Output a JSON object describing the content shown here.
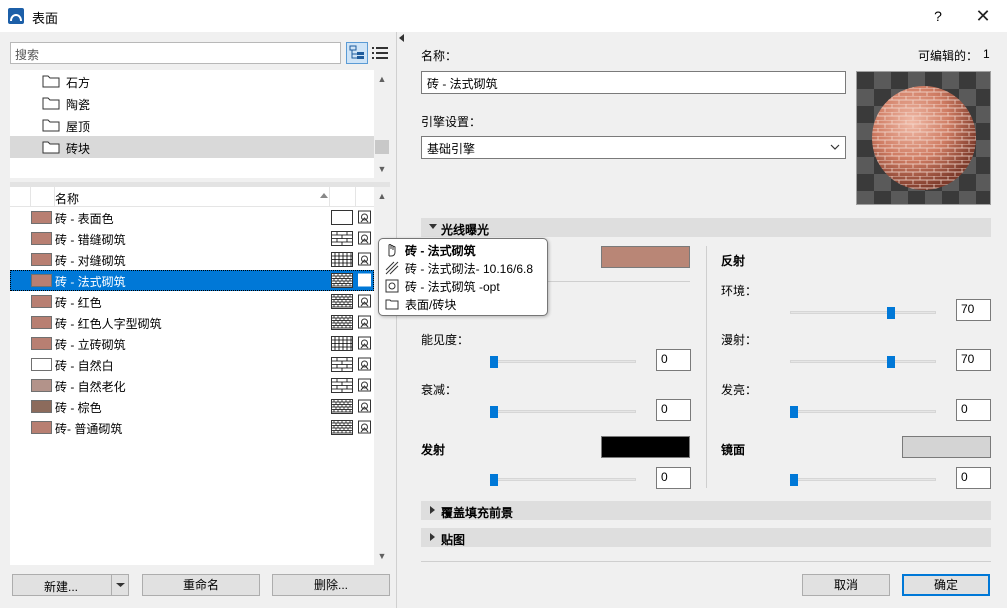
{
  "window": {
    "title": "表面",
    "help_label": "?",
    "close_label": "✕"
  },
  "search": {
    "placeholder": "搜索"
  },
  "folders": [
    {
      "label": "石方"
    },
    {
      "label": "陶瓷"
    },
    {
      "label": "屋顶"
    },
    {
      "label": "砖块",
      "selected": true
    }
  ],
  "material_list": {
    "header_name": "名称",
    "rows": [
      {
        "label": "砖 - 表面色",
        "color": "#b87f72",
        "pattern": "plain"
      },
      {
        "label": "砖 - 错缝砌筑",
        "color": "#b87f72",
        "pattern": "brick"
      },
      {
        "label": "砖 - 对缝砌筑",
        "color": "#b87f72",
        "pattern": "grid"
      },
      {
        "label": "砖 - 法式砌筑",
        "color": "#b87f72",
        "pattern": "dense",
        "selected": true
      },
      {
        "label": "砖 - 红色",
        "color": "#b87f72",
        "pattern": "dense"
      },
      {
        "label": "砖 - 红色人字型砌筑",
        "color": "#b87f72",
        "pattern": "dense"
      },
      {
        "label": "砖 - 立砖砌筑",
        "color": "#b87f72",
        "pattern": "grid"
      },
      {
        "label": "砖 - 自然白",
        "color": "#ffffff",
        "pattern": "brick"
      },
      {
        "label": "砖 - 自然老化",
        "color": "#b3938a",
        "pattern": "brick"
      },
      {
        "label": "砖 - 棕色",
        "color": "#8c6b5c",
        "pattern": "dense"
      },
      {
        "label": "砖- 普通砌筑",
        "color": "#b87f72",
        "pattern": "dense"
      }
    ]
  },
  "tooltip": {
    "lines": [
      {
        "icon": "hand-icon",
        "text": "砖 - 法式砌筑"
      },
      {
        "icon": "hatch-icon",
        "text": "砖 - 法式砌法- 10.16/6.8"
      },
      {
        "icon": "texture-icon",
        "text": "砖 - 法式砌筑 -opt"
      },
      {
        "icon": "folder-icon",
        "text": "表面/砖块"
      }
    ]
  },
  "buttons": {
    "new": "新建...",
    "rename": "重命名",
    "delete": "删除...",
    "cancel": "取消",
    "ok": "确定"
  },
  "details": {
    "name_label": "名称：",
    "name_value": "砖 - 法式砌筑",
    "editable_label": "可编辑的：",
    "editable_count": "1",
    "engine_label": "引擎设置：",
    "engine_value": "基础引擎"
  },
  "sections": {
    "light": "光线曝光",
    "cover": "覆盖填充前景",
    "texture": "贴图"
  },
  "light": {
    "surface_color": "#b98676",
    "visibility_label": "能见度：",
    "visibility_value": "0",
    "attenuation_label": "衰减：",
    "attenuation_value": "0",
    "emission_label": "发射",
    "emission_color": "#000000",
    "emission_value": "0",
    "reflection_label": "反射",
    "ambient_label": "环境：",
    "ambient_value": "70",
    "diffuse_label": "漫射：",
    "diffuse_value": "70",
    "glow_label": "发亮：",
    "glow_value": "0",
    "specular_label": "镜面",
    "specular_color": "#d4d4d4",
    "specular_value": "0"
  }
}
